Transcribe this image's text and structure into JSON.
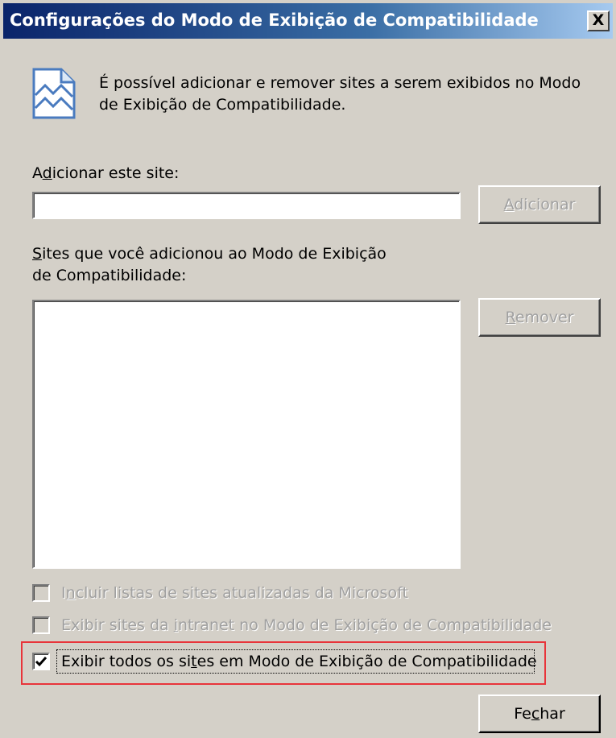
{
  "dialog": {
    "title": "Configurações do Modo de Exibição de Compatibilidade",
    "close_label": "X",
    "info_text": "É possível adicionar e remover sites a serem exibidos no Modo de Exibição de Compatibilidade.",
    "add_site": {
      "label_pre": "A",
      "label_key": "d",
      "label_post": "icionar este site:",
      "value": "",
      "button_pre": "",
      "button_key": "A",
      "button_post": "dicionar"
    },
    "site_list": {
      "label_line1_key": "S",
      "label_line1_post": "ites que você adicionou ao Modo de Exibição",
      "label_line2": "de Compatibilidade:",
      "items": [],
      "button_pre": "",
      "button_key": "R",
      "button_post": "emover"
    },
    "options": [
      {
        "pre": "I",
        "key": "n",
        "post": "cluir listas de sites atualizadas da Microsoft",
        "checked": false,
        "enabled": false
      },
      {
        "pre": "Exibir sites da ",
        "key": "i",
        "post": "ntranet no Modo de Exibição de Compatibilidade",
        "checked": false,
        "enabled": false
      },
      {
        "pre": "Exibir todos os si",
        "key": "t",
        "post": "es em Modo de Exibição de Compatibilidade",
        "checked": true,
        "enabled": true
      }
    ],
    "close_button": {
      "pre": "Fe",
      "key": "c",
      "post": "har"
    },
    "highlight_color": "#e8343a",
    "icon": "compatibility-view-broken-page-icon"
  }
}
